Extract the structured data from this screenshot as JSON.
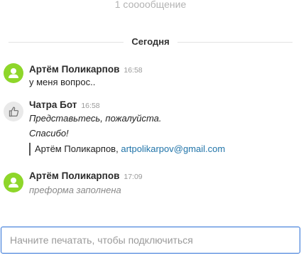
{
  "header": {
    "message_count": "1 сооообщение"
  },
  "divider": {
    "label": "Сегодня"
  },
  "messages": [
    {
      "author": "Артём Поликарпов",
      "time": "16:58",
      "lines": [
        "у меня вопрос.."
      ],
      "avatar_icon": "user-icon"
    },
    {
      "author": "Чатра Бот",
      "time": "16:58",
      "lines": [
        "Представьтесь, пожалуйста.",
        "Спасибо!"
      ],
      "quote": {
        "name": "Артём Поликарпов,",
        "email": "artpolikarpov@gmail.com"
      },
      "avatar_icon": "thumbs-up-icon"
    },
    {
      "author": "Артём Поликарпов",
      "time": "17:09",
      "lines": [
        "преформа заполнена"
      ],
      "avatar_icon": "user-icon"
    }
  ],
  "composer": {
    "placeholder": "Начните печатать, чтобы подключиться"
  },
  "colors": {
    "user_avatar": "#8ed62a",
    "bot_avatar": "#e9e9e9",
    "link": "#1f73a8",
    "input_border": "#2b6fd6"
  }
}
